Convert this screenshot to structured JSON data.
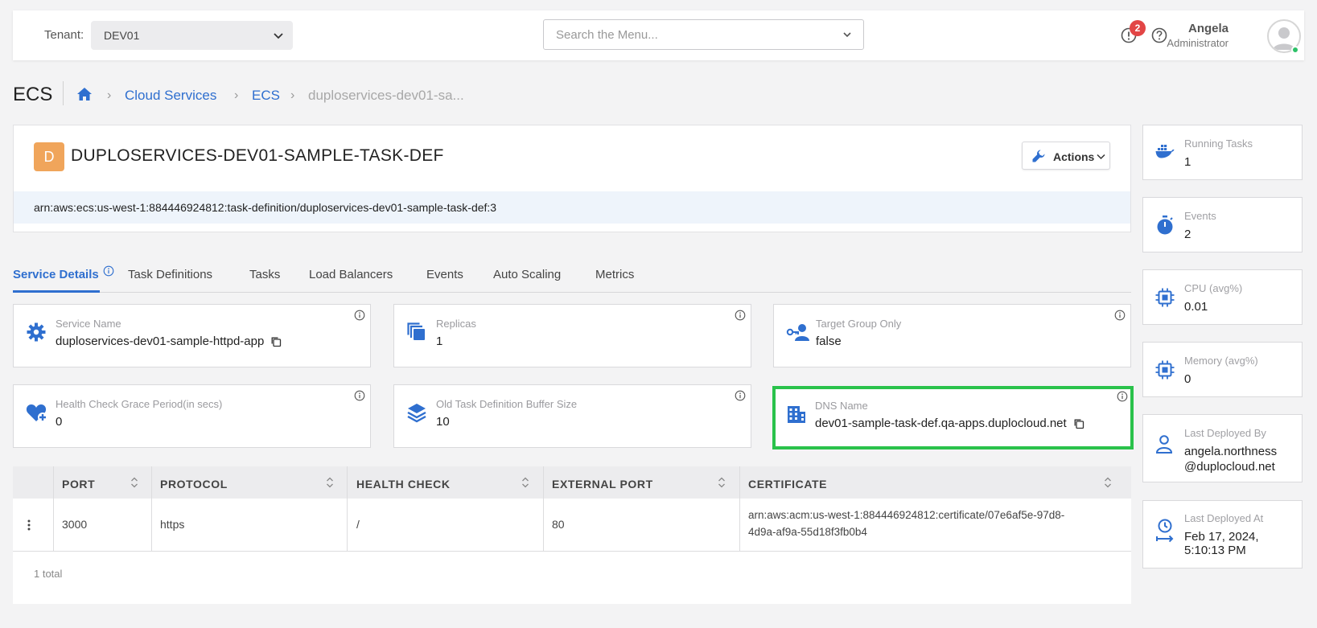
{
  "topbar": {
    "tenant_label": "Tenant:",
    "tenant_value": "DEV01",
    "menu_search_placeholder": "Search the Menu...",
    "alert_count": "2",
    "user_name": "Angela",
    "user_role": "Administrator"
  },
  "page": {
    "title": "ECS",
    "breadcrumb": [
      "Cloud Services",
      "ECS"
    ],
    "breadcrumb_current": "duploservices-dev01-sa..."
  },
  "header": {
    "letter": "D",
    "title": "DUPLOSERVICES-DEV01-SAMPLE-TASK-DEF",
    "actions_label": "Actions",
    "arn": "arn:aws:ecs:us-west-1:884446924812:task-definition/duploservices-dev01-sample-task-def:3"
  },
  "tabs": [
    "Service Details",
    "Task Definitions",
    "Tasks",
    "Load Balancers",
    "Events",
    "Auto Scaling",
    "Metrics"
  ],
  "details": [
    {
      "label": "Service Name",
      "value": "duploservices-dev01-sample-httpd-app",
      "icon": "gear-icon",
      "copyable": true
    },
    {
      "label": "Replicas",
      "value": "1",
      "icon": "copies-icon"
    },
    {
      "label": "Target Group Only",
      "value": "false",
      "icon": "user-key-icon"
    },
    {
      "label": "Health Check Grace Period(in secs)",
      "value": "0",
      "icon": "heart-plus-icon"
    },
    {
      "label": "Old Task Definition Buffer Size",
      "value": "10",
      "icon": "layers-icon"
    },
    {
      "label": "DNS Name",
      "value": "dev01-sample-task-def.qa-apps.duplocloud.net",
      "icon": "building-icon",
      "copyable": true,
      "highlighted": true
    }
  ],
  "table": {
    "columns": [
      "PORT",
      "PROTOCOL",
      "HEALTH CHECK",
      "EXTERNAL PORT",
      "CERTIFICATE"
    ],
    "rows": [
      {
        "port": "3000",
        "protocol": "https",
        "health_check": "/",
        "external_port": "80",
        "certificate_line1": "arn:aws:acm:us-west-1:884446924812:certificate/07e6af5e-97d8-",
        "certificate_line2": "4d9a-af9a-55d18f3fb0b4"
      }
    ],
    "total": "1 total"
  },
  "stats": [
    {
      "label": "Running Tasks",
      "value": "1",
      "icon": "docker-icon"
    },
    {
      "label": "Events",
      "value": "2",
      "icon": "stopwatch-icon"
    },
    {
      "label": "CPU (avg%)",
      "value": "0.01",
      "icon": "cpu-icon"
    },
    {
      "label": "Memory (avg%)",
      "value": "0",
      "icon": "memory-chip-icon"
    },
    {
      "label": "Last Deployed By",
      "value_line1": "angela.northness",
      "value_line2": "@duplocloud.net",
      "icon": "person-icon"
    },
    {
      "label": "Last Deployed At",
      "value_line1": "Feb 17, 2024,",
      "value_line2": "5:10:13 PM",
      "icon": "clock-arrow-icon"
    }
  ],
  "colors": {
    "accent": "#2f6fcf",
    "badge": "#f0a55b",
    "highlight": "#2ac24b",
    "alert": "#e24545"
  }
}
